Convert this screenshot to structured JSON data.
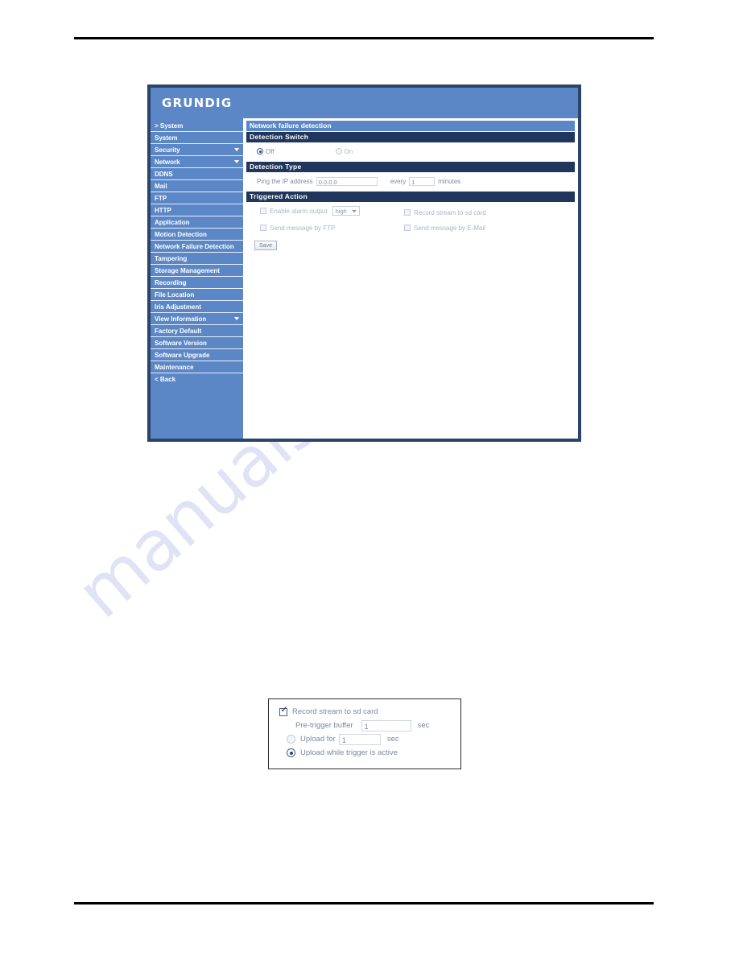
{
  "watermark": {
    "text": "manualshive.com"
  },
  "window": {
    "brand": "GRUNDIG",
    "sidebar": {
      "items": [
        {
          "label": "> System",
          "caret": false,
          "current": true
        },
        {
          "label": "System",
          "caret": false
        },
        {
          "label": "Security",
          "caret": true
        },
        {
          "label": "Network",
          "caret": true
        },
        {
          "label": "DDNS",
          "caret": false
        },
        {
          "label": "Mail",
          "caret": false
        },
        {
          "label": "FTP",
          "caret": false
        },
        {
          "label": "HTTP",
          "caret": false
        },
        {
          "label": "Application",
          "caret": false
        },
        {
          "label": "Motion Detection",
          "caret": false
        },
        {
          "label": "Network Failure Detection",
          "caret": false
        },
        {
          "label": "Tampering",
          "caret": false
        },
        {
          "label": "Storage Management",
          "caret": false
        },
        {
          "label": "Recording",
          "caret": false
        },
        {
          "label": "File Location",
          "caret": false
        },
        {
          "label": "Iris Adjustment",
          "caret": false
        },
        {
          "label": "View Information",
          "caret": true
        },
        {
          "label": "Factory Default",
          "caret": false
        },
        {
          "label": "Software Version",
          "caret": false
        },
        {
          "label": "Software Upgrade",
          "caret": false
        },
        {
          "label": "Maintenance",
          "caret": false
        },
        {
          "label": "< Back",
          "caret": false
        }
      ]
    },
    "page_title": "Network failure detection",
    "detection_switch": {
      "heading": "Detection Switch",
      "off_label": "Off",
      "on_label": "On",
      "selected": "Off"
    },
    "detection_type": {
      "heading": "Detection Type",
      "ping_label": "Ping the IP address",
      "ip_value": "0.0.0.0",
      "every_label": "every",
      "minutes_value": "1",
      "minutes_label": "minutes"
    },
    "triggered_action": {
      "heading": "Triggered Action",
      "enable_alarm_label": "Enable alarm output",
      "alarm_level_value": "high",
      "record_sd_label": "Record stream to sd card",
      "send_ftp_label": "Send message by FTP",
      "send_email_label": "Send message by E-Mail"
    },
    "save_label": "Save"
  },
  "detail_figure": {
    "record_sd_label": "Record stream to sd card",
    "record_sd_checked": true,
    "pre_trigger_label": "Pre-trigger buffer",
    "pre_trigger_value": "1",
    "pre_trigger_unit": "sec",
    "upload_for_label": "Upload for",
    "upload_for_value": "1",
    "upload_for_unit": "sec",
    "upload_while_label": "Upload while trigger is active",
    "selected_upload_mode": "Upload while trigger is active"
  },
  "colors": {
    "brand_blue": "#5b87c6",
    "section_navy": "#21365c",
    "window_border": "#2b4569",
    "watermark": "#cdd2f0"
  }
}
